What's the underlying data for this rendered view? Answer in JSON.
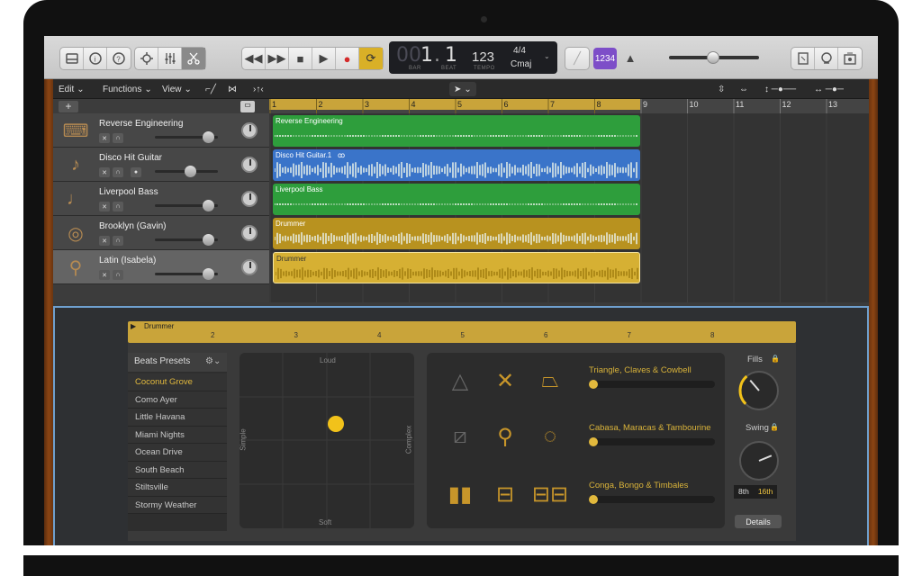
{
  "lcd": {
    "bar": "1",
    "beat": "1",
    "bar_pre": "00",
    "tempo": "123",
    "signature": "4/4",
    "key": "Cmaj",
    "bar_label": "BAR",
    "beat_label": "BEAT",
    "tempo_label": "TEMPO",
    "count_in": "1234"
  },
  "menubar": {
    "edit": "Edit",
    "functions": "Functions",
    "view": "View"
  },
  "ruler": {
    "bars": [
      "1",
      "2",
      "3",
      "4",
      "5",
      "6",
      "7",
      "8",
      "9",
      "10",
      "11",
      "12",
      "13"
    ]
  },
  "tracks": [
    {
      "name": "Reverse Engineering",
      "icon": "synth-icon",
      "region": "Reverse Engineering",
      "color": "#2e9e3c",
      "fader": 0.85
    },
    {
      "name": "Disco Hit Guitar",
      "icon": "guitar-icon",
      "region": "Disco Hit Guitar.1",
      "color": "#3a74c9",
      "fader": 0.57
    },
    {
      "name": "Liverpool Bass",
      "icon": "bass-icon",
      "region": "Liverpool Bass",
      "color": "#2e9e3c",
      "fader": 0.85
    },
    {
      "name": "Brooklyn (Gavin)",
      "icon": "drumkit-icon",
      "region": "Drummer",
      "color": "#b8921f",
      "fader": 0.85
    },
    {
      "name": "Latin (Isabela)",
      "icon": "percussion-icon",
      "region": "Drummer",
      "color": "#d6b033",
      "fader": 0.85
    }
  ],
  "editor": {
    "title": "Drummer",
    "ruler": [
      "2",
      "3",
      "4",
      "5",
      "6",
      "7",
      "8"
    ],
    "presets_label": "Beats Presets",
    "presets": [
      "Coconut Grove",
      "Como Ayer",
      "Little Havana",
      "Miami Nights",
      "Ocean Drive",
      "South Beach",
      "Stiltsville",
      "Stormy Weather"
    ],
    "selected_preset": "Coconut Grove",
    "xy": {
      "top": "Loud",
      "bottom": "Soft",
      "left": "Simple",
      "right": "Complex"
    },
    "groups": [
      "Triangle, Claves & Cowbell",
      "Cabasa, Maracas & Tambourine",
      "Conga, Bongo & Timbales"
    ],
    "fills": "Fills",
    "swing": "Swing",
    "swing_8": "8th",
    "swing_16": "16th",
    "details": "Details",
    "fills_value": 0.35,
    "swing_value": 0.75
  }
}
